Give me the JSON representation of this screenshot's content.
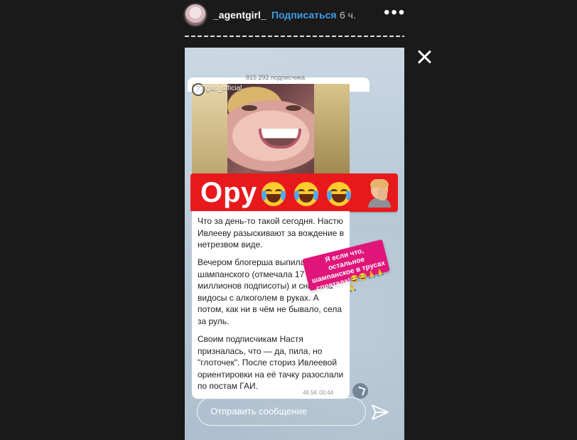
{
  "header": {
    "username": "_agentgirl_",
    "follow_label": "Подписаться",
    "time": "6 ч.",
    "more_label": "•••"
  },
  "story": {
    "card": {
      "subscribers_text": "815 292 подписчика",
      "video_username": "77.gan_official",
      "banner_text": "Ору",
      "banner_emojis": [
        "crying-laughing-emoji",
        "crying-laughing-emoji",
        "crying-laughing-emoji",
        "facepalm-emoji"
      ],
      "paragraphs": [
        "Что за день-то такой сегодня. Настю Ивлееву разыскивают за вождение в нетрезвом виде.",
        "Вечером блогерша выпила шампанского (отмечала 17 миллионов подписоты) и снимала видосы с алкоголем в руках. А потом, как ни в чём не бывало, села за руль.",
        "Своим подписчикам Настя призналась, что — да, пила, но \"глоточек\". После сториз Ивлеевой ориентировки на её тачку разослали по постам ГАИ."
      ],
      "meta": "46,5K 00:44"
    },
    "sticker_text": "Я если что, остальное шампанское в трусах спрятала!😂😂🙏🙏🙏",
    "message_placeholder": "Отправить сообщение"
  },
  "colors": {
    "background": "#1a1a1a",
    "accent": "#3f9ce6",
    "banner": "#e8191c",
    "sticker": "#e0157a"
  },
  "icons": {
    "close": "close-icon",
    "send": "send-icon",
    "more": "more-icon"
  }
}
